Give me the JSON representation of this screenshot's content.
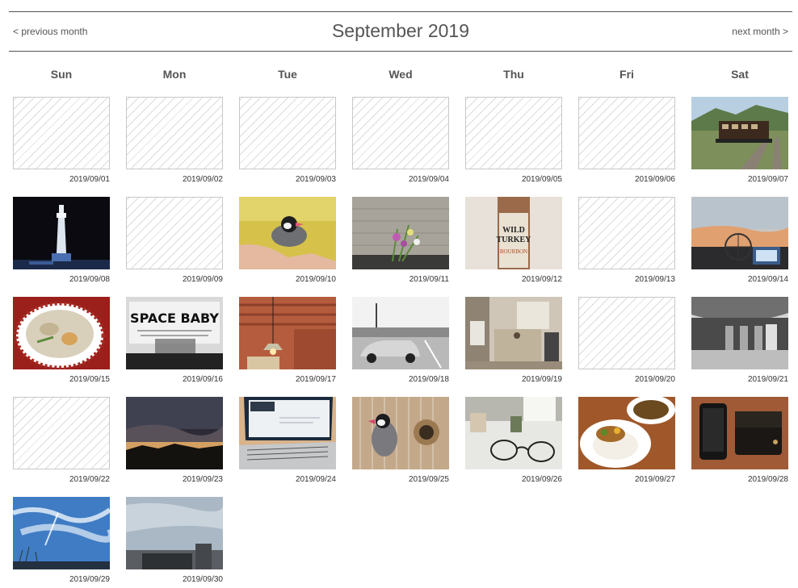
{
  "nav": {
    "prev_label": "< previous month",
    "next_label": "next month >",
    "title": "September 2019"
  },
  "weekdays": [
    "Sun",
    "Mon",
    "Tue",
    "Wed",
    "Thu",
    "Fri",
    "Sat"
  ],
  "days": [
    {
      "date": "2019/09/01",
      "has_photo": false
    },
    {
      "date": "2019/09/02",
      "has_photo": false
    },
    {
      "date": "2019/09/03",
      "has_photo": false
    },
    {
      "date": "2019/09/04",
      "has_photo": false
    },
    {
      "date": "2019/09/05",
      "has_photo": false
    },
    {
      "date": "2019/09/06",
      "has_photo": false
    },
    {
      "date": "2019/09/07",
      "has_photo": true,
      "photo": "train-in-countryside"
    },
    {
      "date": "2019/09/08",
      "has_photo": true,
      "photo": "tower-at-night"
    },
    {
      "date": "2019/09/09",
      "has_photo": false
    },
    {
      "date": "2019/09/10",
      "has_photo": true,
      "photo": "sparrow-on-hand"
    },
    {
      "date": "2019/09/11",
      "has_photo": true,
      "photo": "flowers-by-wall"
    },
    {
      "date": "2019/09/12",
      "has_photo": true,
      "photo": "whiskey-bottle",
      "photo_text": [
        "WILD",
        "TURKEY",
        "BOURBON"
      ]
    },
    {
      "date": "2019/09/13",
      "has_photo": false
    },
    {
      "date": "2019/09/14",
      "has_photo": true,
      "photo": "sunset-ferris-wheel"
    },
    {
      "date": "2019/09/15",
      "has_photo": true,
      "photo": "ramen-bowl"
    },
    {
      "date": "2019/09/16",
      "has_photo": true,
      "photo": "space-baby-sign",
      "photo_text": [
        "SPACE BABY"
      ]
    },
    {
      "date": "2019/09/17",
      "has_photo": true,
      "photo": "pendant-lamp"
    },
    {
      "date": "2019/09/18",
      "has_photo": true,
      "photo": "car-parking-lot"
    },
    {
      "date": "2019/09/19",
      "has_photo": true,
      "photo": "kitchen-room"
    },
    {
      "date": "2019/09/20",
      "has_photo": false
    },
    {
      "date": "2019/09/21",
      "has_photo": true,
      "photo": "station-hall"
    },
    {
      "date": "2019/09/22",
      "has_photo": false
    },
    {
      "date": "2019/09/23",
      "has_photo": true,
      "photo": "dusk-sky"
    },
    {
      "date": "2019/09/24",
      "has_photo": true,
      "photo": "laptop"
    },
    {
      "date": "2019/09/25",
      "has_photo": true,
      "photo": "bird-in-cage"
    },
    {
      "date": "2019/09/26",
      "has_photo": true,
      "photo": "glasses-on-table"
    },
    {
      "date": "2019/09/27",
      "has_photo": true,
      "photo": "curry-rice-plate"
    },
    {
      "date": "2019/09/28",
      "has_photo": true,
      "photo": "phone-and-wallet"
    },
    {
      "date": "2019/09/29",
      "has_photo": true,
      "photo": "blue-sky-clouds"
    },
    {
      "date": "2019/09/30",
      "has_photo": true,
      "photo": "sky-over-building"
    }
  ]
}
